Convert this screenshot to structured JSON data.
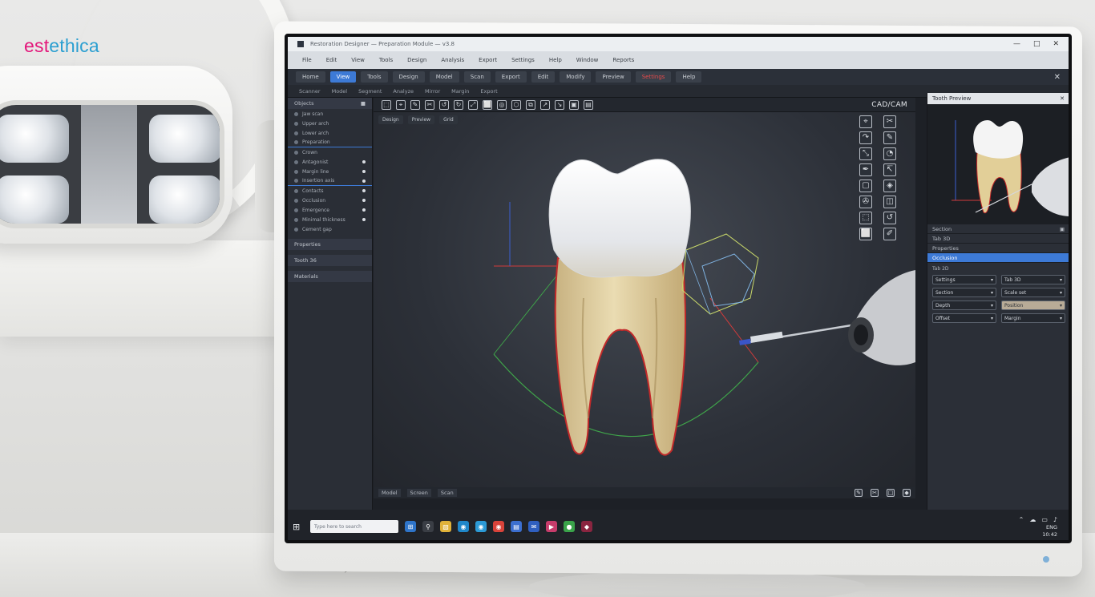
{
  "brand": {
    "part1": "est",
    "part2": "ethica"
  },
  "window": {
    "title": "Restoration Designer — Preparation Module — v3.8",
    "min": "—",
    "max": "□",
    "close": "✕"
  },
  "menu": [
    "File",
    "Edit",
    "View",
    "Tools",
    "Design",
    "Analysis",
    "Export",
    "Settings",
    "Help",
    "Window",
    "Reports"
  ],
  "ribbon": {
    "tabs": [
      "Home",
      "View",
      "Tools",
      "Design",
      "Model",
      "Scan",
      "Export",
      "Edit",
      "Modify",
      "Preview",
      "Settings",
      "Help"
    ],
    "active_index": 1,
    "close": "✕"
  },
  "subbar": [
    "Scanner",
    "Model",
    "Segment",
    "Analyze",
    "Mirror",
    "Margin",
    "Export"
  ],
  "left_panel": {
    "header": "Objects",
    "rows": [
      "Jaw scan",
      "Upper arch",
      "Lower arch",
      "Preparation",
      "Crown",
      "Antagonist",
      "Margin line",
      "Insertion axis",
      "Contacts",
      "Occlusion",
      "Emergence",
      "Minimal thickness",
      "Cement gap"
    ],
    "section1": "Properties",
    "section2": "Tooth 36",
    "section3": "Materials"
  },
  "viewport": {
    "label": "CAD/CAM",
    "tabs": [
      "Design",
      "Preview",
      "Grid"
    ],
    "tools": [
      "⬚",
      "⌖",
      "✎",
      "✂",
      "↺",
      "↻",
      "⤢",
      "⬜",
      "◎",
      "⬡",
      "⧉",
      "↗",
      "↘",
      "▣",
      "▤"
    ],
    "right_tools": [
      "⌖",
      "✂",
      "↷",
      "✎",
      "⤡",
      "◔",
      "✒",
      "↸",
      "▢",
      "◈",
      "✇",
      "◫",
      "⬚",
      "↺",
      "⬜",
      "✐"
    ]
  },
  "bottom_tabs": [
    "Model",
    "Screen",
    "Scan"
  ],
  "right_panel": {
    "header": "Tooth Preview",
    "close": "✕",
    "bars": [
      "Section",
      "Tab 3D",
      "Properties",
      "Occlusion"
    ],
    "highlight_index": 3,
    "fields_label": "Tab 2D",
    "fields": [
      "Settings",
      "Tab 3D",
      "Section",
      "Scale set",
      "Depth",
      "Position",
      "Offset",
      "Margin"
    ]
  },
  "taskbar": {
    "start": "⊞",
    "search_placeholder": "Type here to search",
    "tray_icons": [
      "⌃",
      "☁",
      "▭",
      "♪"
    ],
    "tray_text1": "ENG",
    "tray_text2": "10:42"
  },
  "colors": {
    "accent": "#3d7ad6",
    "brand_pink": "#e3177b",
    "brand_blue": "#2b9fd1"
  }
}
